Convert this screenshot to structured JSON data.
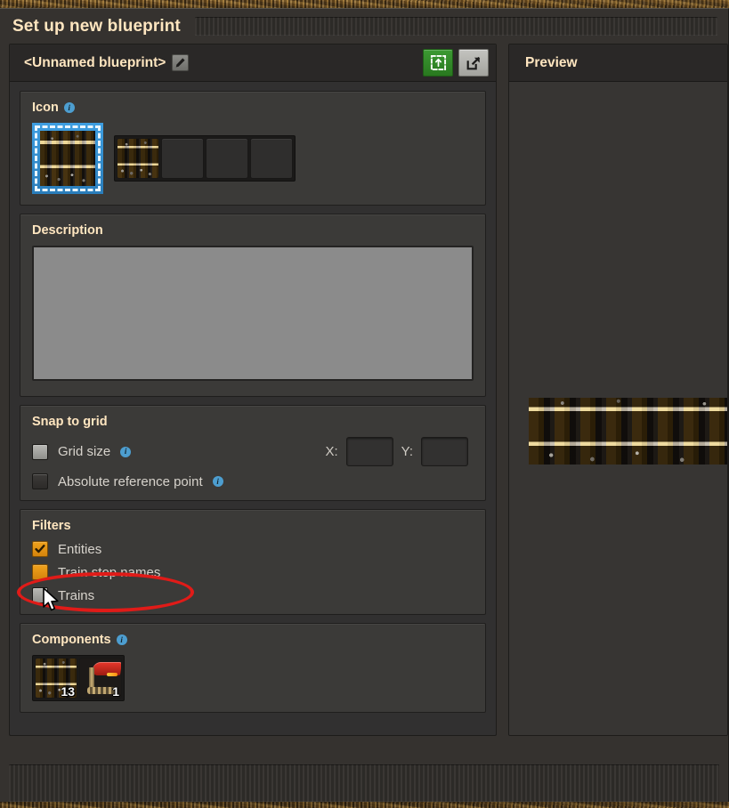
{
  "window": {
    "title": "Set up new blueprint"
  },
  "blueprint_header": {
    "name": "<Unnamed blueprint>",
    "edit_icon": "pencil-icon",
    "select_button_icon": "select-new-contents-icon",
    "export_button_icon": "export-to-string-icon"
  },
  "icon_section": {
    "title": "Icon",
    "info_marker": "i",
    "slot_count": 4,
    "slots": [
      {
        "filled": true,
        "icon": "rail-icon"
      },
      {
        "filled": false,
        "icon": ""
      },
      {
        "filled": false,
        "icon": ""
      },
      {
        "filled": false,
        "icon": ""
      }
    ],
    "preview_icon": "rail-icon"
  },
  "description_section": {
    "title": "Description",
    "value": "",
    "placeholder": ""
  },
  "snap_section": {
    "title": "Snap to grid",
    "rows": [
      {
        "label": "Grid size",
        "checked": false,
        "style": "off-light",
        "has_info": true,
        "info_marker": "i"
      },
      {
        "label": "Absolute reference point",
        "checked": false,
        "style": "off-dark",
        "has_info": true,
        "info_marker": "i"
      }
    ],
    "x_label": "X:",
    "x_value": "",
    "y_label": "Y:",
    "y_value": ""
  },
  "filters_section": {
    "title": "Filters",
    "rows": [
      {
        "label": "Entities",
        "checked": true,
        "style": "on-orange",
        "has_info": false
      },
      {
        "label": "Train stop names",
        "checked": true,
        "style": "on-orange",
        "has_info": false,
        "hovered": true
      },
      {
        "label": "Trains",
        "checked": false,
        "style": "off-light",
        "has_info": false
      }
    ]
  },
  "components_section": {
    "title": "Components",
    "info_marker": "i",
    "items": [
      {
        "icon": "rail-icon",
        "count": "13"
      },
      {
        "icon": "train-stop-icon",
        "count": "1"
      }
    ]
  },
  "preview_panel": {
    "title": "Preview",
    "content_icon": "rail-track-preview"
  },
  "annotation": {
    "shape": "ellipse",
    "color": "#e01b18",
    "target": "Train stop names",
    "cursor": "arrow-cursor"
  },
  "colors": {
    "accent_title": "#ffe6c0",
    "checkbox_on": "#f0a21c",
    "green_button": "#3c9a33",
    "info_blue": "#4d9ed0",
    "annotation_red": "#e01b18",
    "panel_bg": "#313030",
    "section_bg": "#3b3a38"
  }
}
